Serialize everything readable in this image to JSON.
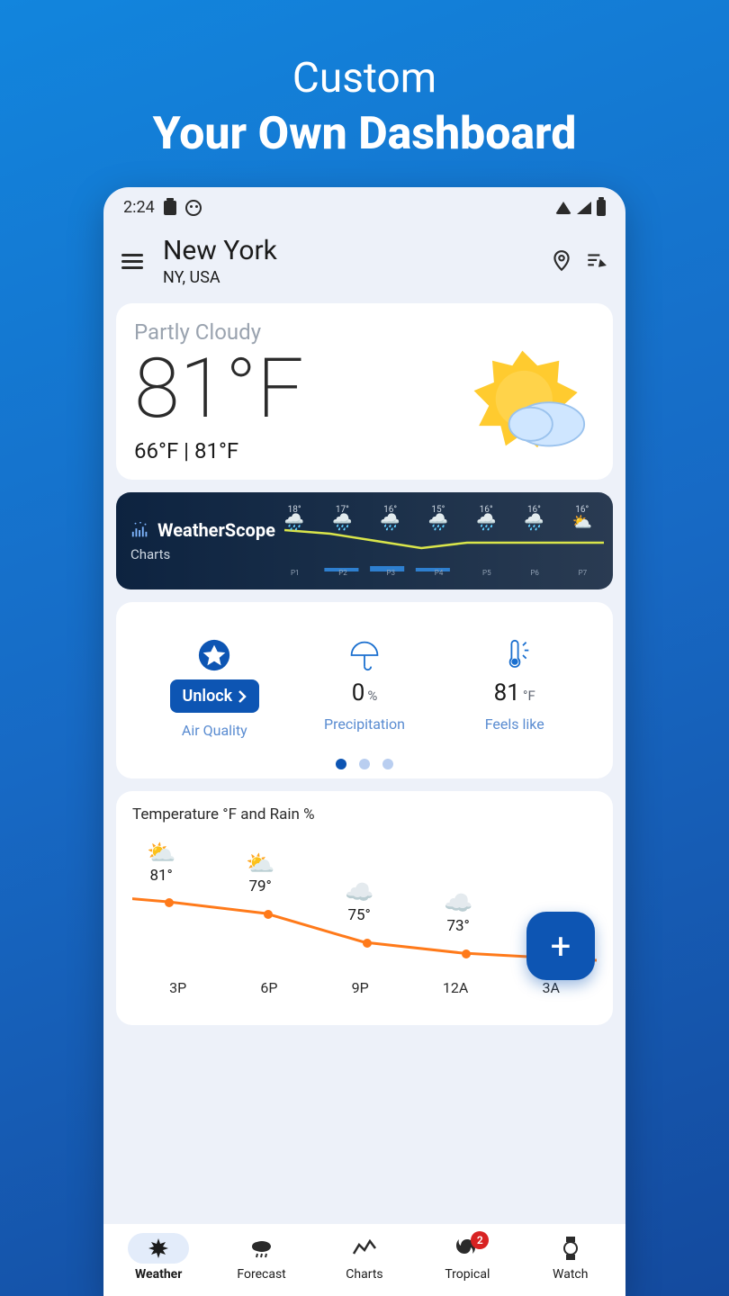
{
  "promo": {
    "line1": "Custom",
    "line2": "Your Own Dashboard"
  },
  "status_bar": {
    "time": "2:24"
  },
  "header": {
    "city": "New York",
    "region": "NY, USA"
  },
  "current": {
    "condition": "Partly Cloudy",
    "temp": "81°F",
    "low": "66°F",
    "high": "81°F"
  },
  "banner": {
    "title": "WeatherScope",
    "subtitle": "Charts",
    "mini_forecast": [
      {
        "temp": "18°",
        "label": "P1"
      },
      {
        "temp": "17°",
        "label": "P2"
      },
      {
        "temp": "16°",
        "label": "P3"
      },
      {
        "temp": "15°",
        "label": "P4"
      },
      {
        "temp": "16°",
        "label": "P5"
      },
      {
        "temp": "16°",
        "label": "P6"
      },
      {
        "temp": "16°",
        "label": "P7"
      }
    ]
  },
  "metrics": {
    "unlock_label": "Unlock",
    "air_quality_label": "Air Quality",
    "precip_value": "0",
    "precip_unit": "%",
    "precip_label": "Precipitation",
    "feels_value": "81",
    "feels_unit": "°F",
    "feels_label": "Feels like",
    "active_dot": 0,
    "dot_count": 3
  },
  "hourly": {
    "title": "Temperature °F and Rain %",
    "points": [
      {
        "time": "3P",
        "temp": "81°",
        "icon": "partly-sunny"
      },
      {
        "time": "6P",
        "temp": "79°",
        "icon": "partly-sunny"
      },
      {
        "time": "9P",
        "temp": "75°",
        "icon": "night-cloudy"
      },
      {
        "time": "12A",
        "temp": "73°",
        "icon": "night-cloudy"
      },
      {
        "time": "3A",
        "temp": "",
        "icon": ""
      }
    ]
  },
  "chart_data": {
    "type": "line",
    "title": "Temperature °F and Rain %",
    "x": [
      "3P",
      "6P",
      "9P",
      "12A",
      "3A"
    ],
    "series": [
      {
        "name": "Temperature °F",
        "values": [
          81,
          79,
          75,
          73,
          72
        ]
      }
    ],
    "xlabel": "",
    "ylabel": "°F"
  },
  "fab": {
    "label": "+"
  },
  "nav": {
    "items": [
      {
        "label": "Weather",
        "active": true,
        "icon": "sun-burst"
      },
      {
        "label": "Forecast",
        "active": false,
        "icon": "rain-cloud"
      },
      {
        "label": "Charts",
        "active": false,
        "icon": "line-chart"
      },
      {
        "label": "Tropical",
        "active": false,
        "icon": "storm",
        "badge": "2"
      },
      {
        "label": "Watch",
        "active": false,
        "icon": "watch"
      }
    ]
  }
}
